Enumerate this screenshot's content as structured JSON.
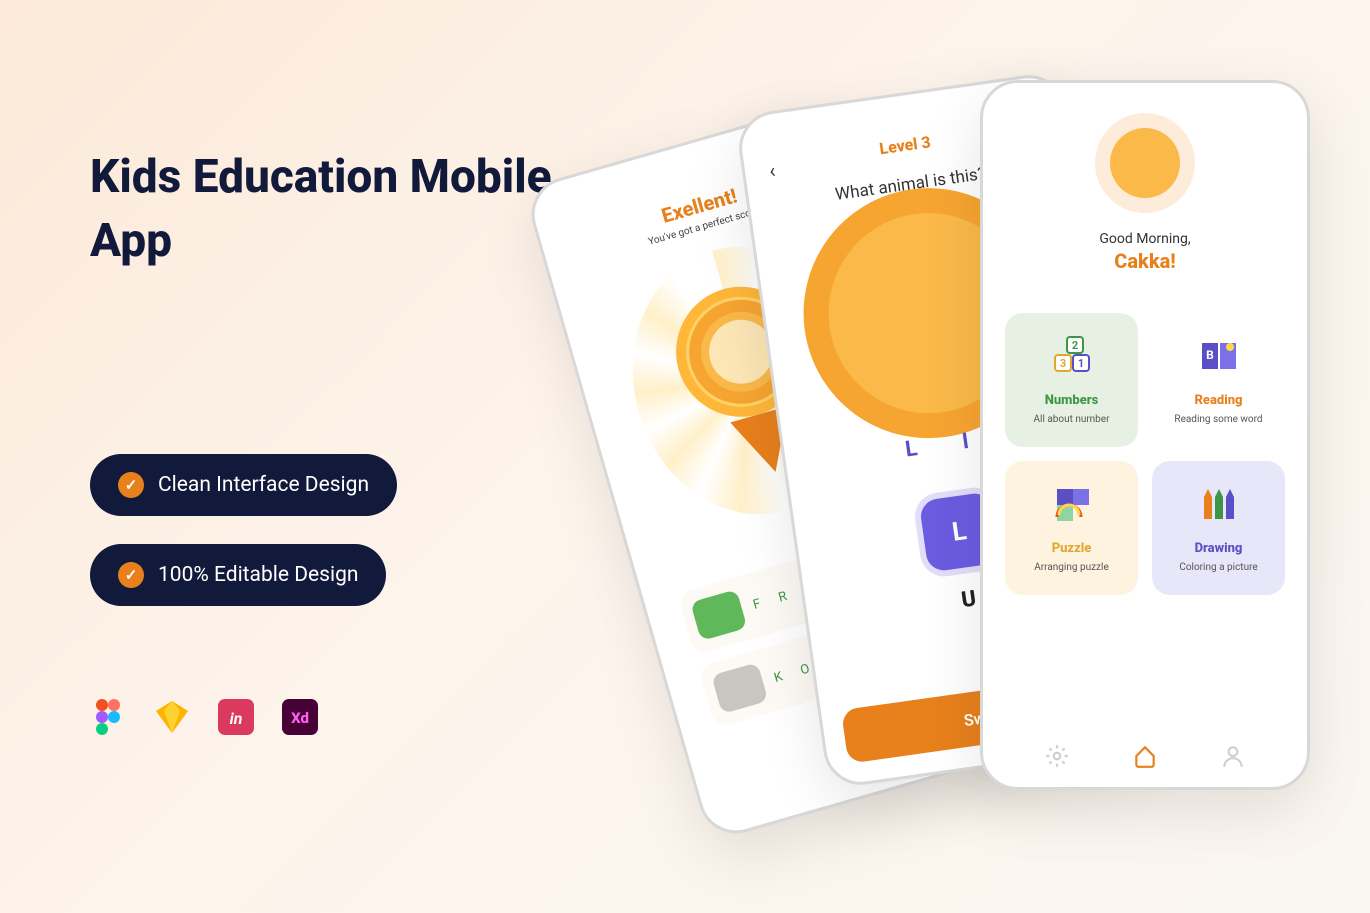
{
  "headline": "Kids Education Mobile App",
  "pills": {
    "design": "Clean Interface Design",
    "editable": "100% Editable Design"
  },
  "tool_icons": [
    "figma-icon",
    "sketch-icon",
    "invision-icon",
    "xd-icon"
  ],
  "phone1": {
    "headline": "Exellent!",
    "sub": "You've got a perfect score!",
    "row1_letters": "F  R  O",
    "row2_letters": "K  O"
  },
  "phone2": {
    "level": "Level 3",
    "question": "What animal is this?",
    "blanks": "L  I",
    "key": "L",
    "u": "U",
    "swipe": "Swipe"
  },
  "phone3": {
    "greeting": "Good Morning,",
    "username": "Cakka!",
    "cats": {
      "numbers": {
        "title": "Numbers",
        "sub": "All about number"
      },
      "reading": {
        "title": "Reading",
        "sub": "Reading some word"
      },
      "puzzle": {
        "title": "Puzzle",
        "sub": "Arranging puzzle"
      },
      "drawing": {
        "title": "Drawing",
        "sub": "Coloring a picture"
      }
    }
  }
}
